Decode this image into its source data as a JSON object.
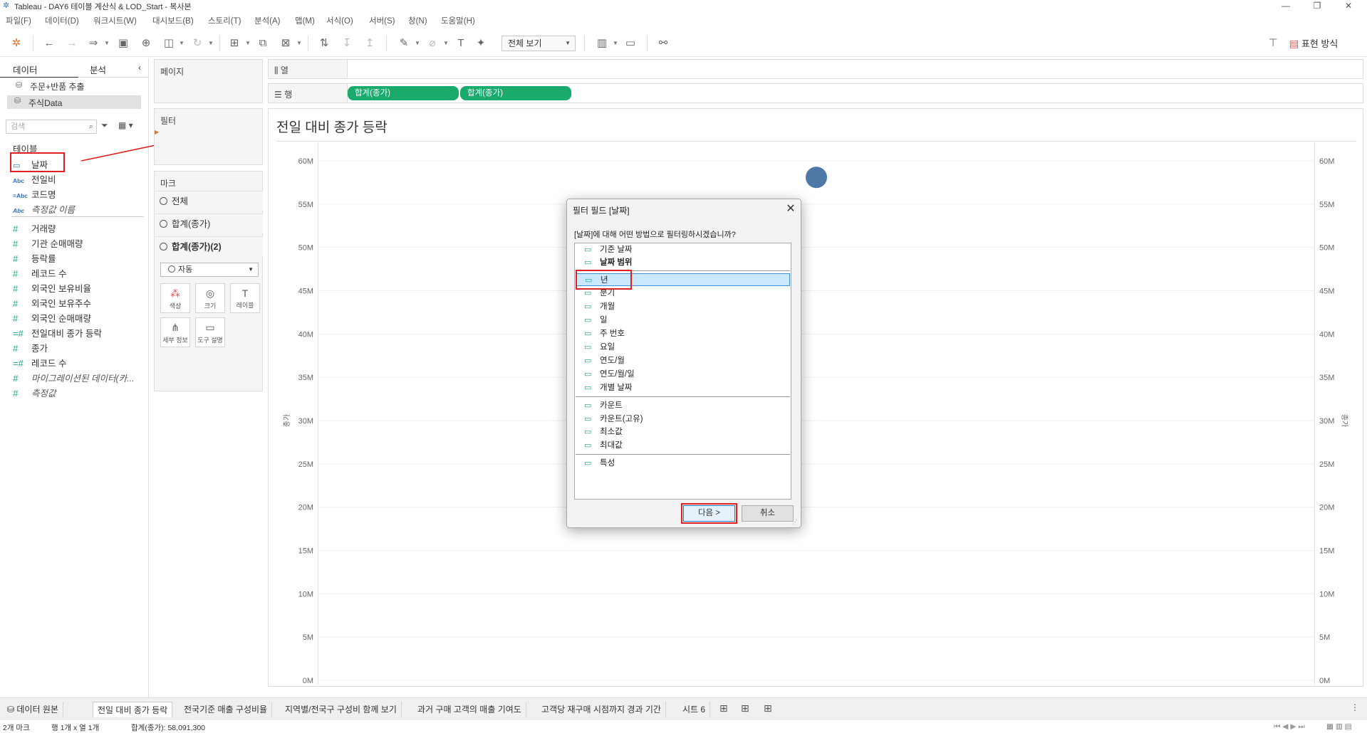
{
  "window": {
    "title": "Tableau - DAY6 테이블 계산식 & LOD_Start - 복사본"
  },
  "menu": [
    "파일(F)",
    "데이터(D)",
    "워크시트(W)",
    "대시보드(B)",
    "스토리(T)",
    "분석(A)",
    "맵(M)",
    "서식(O)",
    "서버(S)",
    "창(N)",
    "도움말(H)"
  ],
  "toolbar": {
    "view_select": "전체 보기",
    "show_me": "표현 방식"
  },
  "data_pane": {
    "tab_data": "데이터",
    "tab_analytics": "분석",
    "datasources": [
      "주문+반품 추출",
      "주식Data"
    ],
    "search_placeholder": "검색",
    "tables_header": "테이블",
    "dimensions": [
      {
        "label": "날짜",
        "icon": "calendar-icon"
      },
      {
        "label": "전일비",
        "icon": "abc-icon"
      },
      {
        "label": "코드명",
        "icon": "abc-icon"
      },
      {
        "label": "측정값 이름",
        "icon": "abc-icon"
      }
    ],
    "measures": [
      "거래량",
      "기관 순매매량",
      "등락률",
      "레코드 수",
      "외국인 보유비율",
      "외국인 보유주수",
      "외국인 순매매량",
      "전일대비 종가 등락",
      "종가",
      "레코드 수",
      "마이그레이션된 데이터(카...",
      "측정값"
    ]
  },
  "cards": {
    "pages": "페이지",
    "filters": "필터",
    "marks": "마크",
    "marks_rows": [
      "전체",
      "합계(종가)",
      "합계(종가)(2)"
    ],
    "mark_type": "자동",
    "mark_buttons": [
      "색상",
      "크기",
      "레이블",
      "세부 정보",
      "도구 설명"
    ]
  },
  "shelves": {
    "columns_label": "열",
    "rows_label": "행",
    "row_pills": [
      "합계(종가)",
      "합계(종가)"
    ]
  },
  "view": {
    "title": "전일 대비 종가 등락",
    "y_axis_title": "종가",
    "colors": {
      "mark": "#4e79a7",
      "pill": "#1aaa6b"
    }
  },
  "chart_data": {
    "type": "scatter",
    "title": "전일 대비 종가 등락",
    "ylabel": "종가",
    "y_ticks": [
      "60M",
      "55M",
      "50M",
      "45M",
      "40M",
      "35M",
      "30M",
      "25M",
      "20M",
      "15M",
      "10M",
      "5M",
      "0M"
    ],
    "ylim": [
      0,
      60000000
    ],
    "series": [
      {
        "values": [
          58091300
        ]
      }
    ],
    "dual_axis": true
  },
  "dialog": {
    "title": "필터 필드 [날짜]",
    "question": "[날짜]에 대해 어떤 방법으로 필터링하시겠습니까?",
    "group1": [
      "기준 날짜",
      "날짜 범위"
    ],
    "group2": [
      "년",
      "분기",
      "개월",
      "일",
      "주 번호",
      "요일",
      "연도/월",
      "연도/월/일",
      "개별 날짜"
    ],
    "group3": [
      "카운트",
      "카운트(고유)",
      "최소값",
      "최대값"
    ],
    "group4": [
      "특성"
    ],
    "selected": "년",
    "next_label": "다음 >",
    "cancel_label": "취소"
  },
  "sheet_tabs": [
    "데이터 원본",
    "전일 대비 종가 등락",
    "전국기준 매출 구성비율",
    "지역별/전국구 구성비 함께 보기",
    "과거 구매 고객의 매출 기여도",
    "고객당 재구매 시점까지 경과 기간",
    "시트 6"
  ],
  "status": {
    "marks": "2개 마크",
    "rows_cols": "행 1개 x 열 1개",
    "sum": "합계(종가): 58,091,300"
  }
}
